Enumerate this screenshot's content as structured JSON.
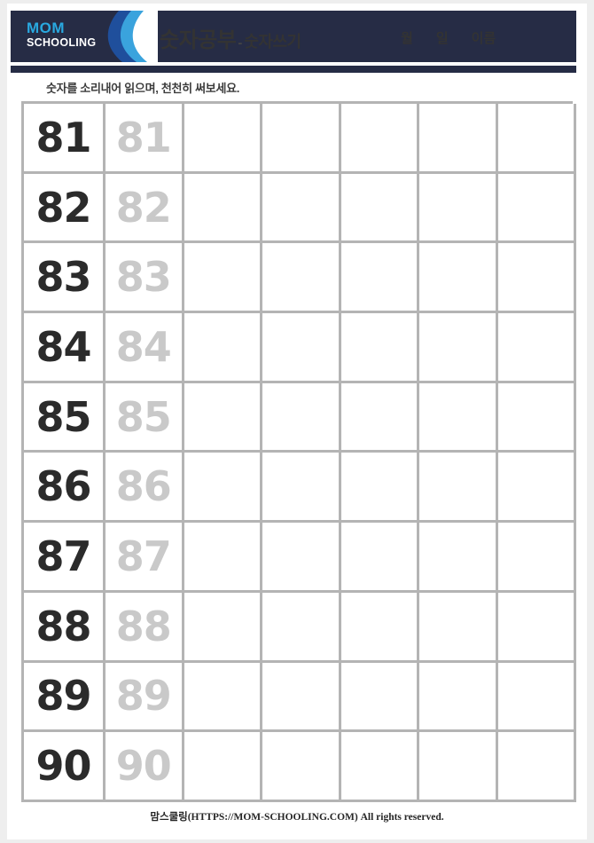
{
  "page": {
    "background_color": "#eeeeee",
    "sheet_color": "#ffffff"
  },
  "header": {
    "background_color": "#262c45",
    "logo": {
      "line1": "MOM",
      "line2": "SCHOOLING",
      "line1_color": "#29a9e0",
      "line2_color": "#ffffff",
      "wave_dark": "#1a3a6b",
      "wave_mid": "#2f7fc4",
      "wave_light": "#4db8e8"
    },
    "title_main": "숫자공부",
    "title_separator": "-",
    "title_sub": "숫자쓰기",
    "meta_fields": [
      "월",
      "일",
      "이름"
    ]
  },
  "instruction": "숫자를 소리내어 읽으며, 천천히 써보세요.",
  "worksheet": {
    "columns": 7,
    "rows": 10,
    "border_color": "#b4b4b4",
    "solid_color": "#2b2b2b",
    "trace_color": "#c9c9c9",
    "items": [
      {
        "solid": "81",
        "trace": "81"
      },
      {
        "solid": "82",
        "trace": "82"
      },
      {
        "solid": "83",
        "trace": "83"
      },
      {
        "solid": "84",
        "trace": "84"
      },
      {
        "solid": "85",
        "trace": "85"
      },
      {
        "solid": "86",
        "trace": "86"
      },
      {
        "solid": "87",
        "trace": "87"
      },
      {
        "solid": "88",
        "trace": "88"
      },
      {
        "solid": "89",
        "trace": "89"
      },
      {
        "solid": "90",
        "trace": "90"
      }
    ]
  },
  "footer": {
    "text": "맘스쿨링(HTTPS://MOM-SCHOOLING.COM) All rights reserved."
  }
}
